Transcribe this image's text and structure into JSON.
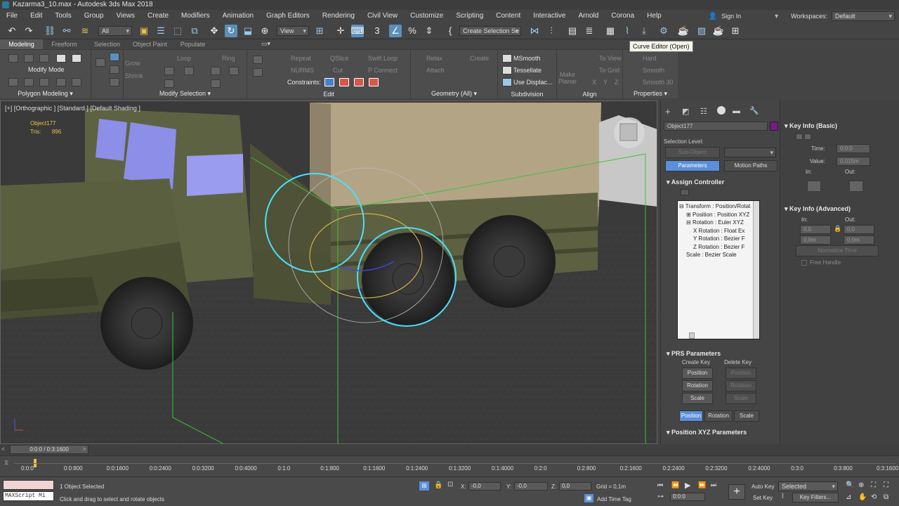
{
  "window": {
    "title": "Kazarma3_10.max - Autodesk 3ds Max 2018"
  },
  "menu": {
    "items": [
      "File",
      "Edit",
      "Tools",
      "Group",
      "Views",
      "Create",
      "Modifiers",
      "Animation",
      "Graph Editors",
      "Rendering",
      "Civil View",
      "Customize",
      "Scripting",
      "Content",
      "Interactive",
      "Arnold",
      "Corona",
      "Help"
    ],
    "signin": "Sign In",
    "workspaces_label": "Workspaces:",
    "workspaces_value": "Default"
  },
  "toolbar": {
    "filter": "All",
    "view": "View",
    "selection_set": "Create Selection Se",
    "tooltip": "Curve Editor (Open)"
  },
  "ribbon": {
    "tabs": [
      "Modeling",
      "Freeform",
      "Selection",
      "Object Paint",
      "Populate"
    ],
    "active_tab": "Modeling",
    "groups": {
      "polygon_modeling": "Polygon Modeling",
      "modify_selection": "Modify Selection",
      "edit": "Edit",
      "geometry": "Geometry (All)",
      "subdivision": "Subdivision",
      "align": "Align",
      "properties": "Properties"
    },
    "modify_mode": "Modify Mode",
    "grow": "Grow",
    "shrink": "Shrink",
    "loop": "Loop",
    "ring": "Ring",
    "repeat": "Repeat",
    "qslice": "QSlice",
    "swift_loop": "Swift Loop",
    "nurms": "NURMS",
    "cut": "Cut",
    "p_connect": "P Connect",
    "constraints": "Constraints:",
    "relax": "Relax",
    "create": "Create",
    "attach": "Attach",
    "msmooth": "MSmooth",
    "tessellate": "Tessellate",
    "use_displac": "Use Displac...",
    "make_planar": "Make Planar",
    "to_view": "To View",
    "to_grid": "To Grid",
    "x": "X",
    "y": "Y",
    "z": "Z",
    "hard": "Hard",
    "smooth": "Smooth",
    "smooth30": "Smooth 30"
  },
  "viewport": {
    "label": "[+] [Orthographic ] [Standard ] [Default Shading ]",
    "object_name": "Object177",
    "tris_label": "Tris:",
    "tris_value": "896"
  },
  "command_panel": {
    "object_name": "Object177",
    "object_color": "#7a1a8a",
    "selection_level": "Selection Level:",
    "sub_object": "Sub-Object",
    "tabs": [
      "Parameters",
      "Motion Paths"
    ],
    "assign_controller": "Assign Controller",
    "tree": [
      "Transform : Position/Rotat",
      "Position : Position XYZ",
      "Rotation : Euler XYZ",
      "X Rotation : Float Ex",
      "Y Rotation : Bezier F",
      "Z Rotation : Bezier F",
      "Scale : Bezier Scale"
    ],
    "prs": "PRS Parameters",
    "create_key": "Create Key",
    "delete_key": "Delete Key",
    "keys": [
      "Position",
      "Rotation",
      "Scale"
    ],
    "bottom_tabs": [
      "Position",
      "Rotation",
      "Scale"
    ],
    "pos_xyz": "Position XYZ Parameters"
  },
  "key_panel": {
    "basic": "Key Info (Basic)",
    "time_label": "Time:",
    "time_value": "0:0:0",
    "value_label": "Value:",
    "value_value": "0,015m",
    "in": "In:",
    "out": "Out:",
    "advanced": "Key Info (Advanced)",
    "in_value": "0,0",
    "out_value": "0,0",
    "in2": "0,0m",
    "out2": "0,0m",
    "normalize": "Normalize Time",
    "free_handle": "Free Handle"
  },
  "timeline": {
    "slider": "0:0:0 / 0:3:1600",
    "ticks": [
      "0:0:0",
      "0:0:800",
      "0:0:1600",
      "0:0:2400",
      "0:0:3200",
      "0:0:4000",
      "0:1:0",
      "0:1:800",
      "0:1:1600",
      "0:1:2400",
      "0:1:3200",
      "0:1:4000",
      "0:2:0",
      "0:2:800",
      "0:2:1600",
      "0:2:2400",
      "0:2:3200",
      "0:2:4000",
      "0:3:0",
      "0:3:800",
      "0:3:1600"
    ]
  },
  "status": {
    "maxscript": "MAXScript Mi",
    "selected": "1 Object Selected",
    "hint": "Click and drag to select and rotate objects",
    "x_label": "X:",
    "x_value": "-0,0",
    "y_label": "Y:",
    "y_value": "-0,0",
    "z_label": "Z:",
    "z_value": "0,0",
    "grid": "Grid = 0,1m",
    "add_time_tag": "Add Time Tag",
    "auto_key": "Auto Key",
    "set_key": "Set Key",
    "selected_dd": "Selected",
    "key_filters": "Key Filters...",
    "frame": "0:0:0"
  }
}
